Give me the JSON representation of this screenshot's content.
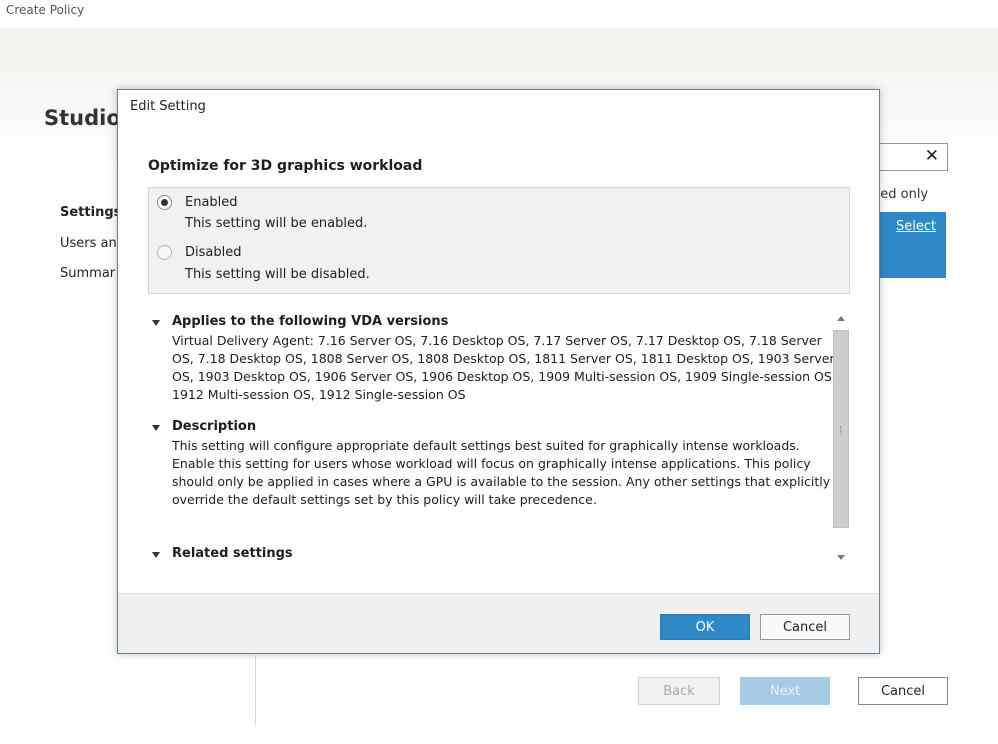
{
  "window": {
    "title": "Create Policy"
  },
  "background": {
    "studio_label": "Studio",
    "nav": [
      "Settings",
      "Users an",
      "Summar"
    ],
    "selected_only": "cted only",
    "select_link": "Select",
    "buttons": {
      "back": "Back",
      "next": "Next",
      "cancel": "Cancel"
    }
  },
  "dialog": {
    "title": "Edit Setting",
    "heading": "Optimize for 3D graphics workload",
    "options": [
      {
        "label": "Enabled",
        "description": "This setting will be enabled.",
        "checked": true
      },
      {
        "label": "Disabled",
        "description": "This setting will be disabled.",
        "checked": false
      }
    ],
    "sections": {
      "applies": {
        "title": "Applies to the following VDA versions",
        "body": "Virtual Delivery Agent: 7.16 Server OS, 7.16 Desktop OS, 7.17 Server OS, 7.17 Desktop OS, 7.18 Server OS, 7.18 Desktop OS, 1808 Server OS, 1808 Desktop OS, 1811 Server OS, 1811 Desktop OS, 1903 Server OS, 1903 Desktop OS, 1906 Server OS, 1906 Desktop OS, 1909 Multi-session OS, 1909 Single-session OS, 1912 Multi-session OS, 1912 Single-session OS"
      },
      "description": {
        "title": "Description",
        "body": "This setting will configure appropriate default settings best suited for graphically intense workloads. Enable this setting for users whose workload will focus on graphically intense applications. This policy should only be applied in cases where a GPU is available to the session. Any other settings that explicitly override the default settings set by this policy will take precedence."
      },
      "related": {
        "title": "Related settings"
      }
    },
    "buttons": {
      "ok": "OK",
      "cancel": "Cancel"
    }
  },
  "colors": {
    "accent": "#2f89c7",
    "dialog_border": "#3c8ccb"
  }
}
